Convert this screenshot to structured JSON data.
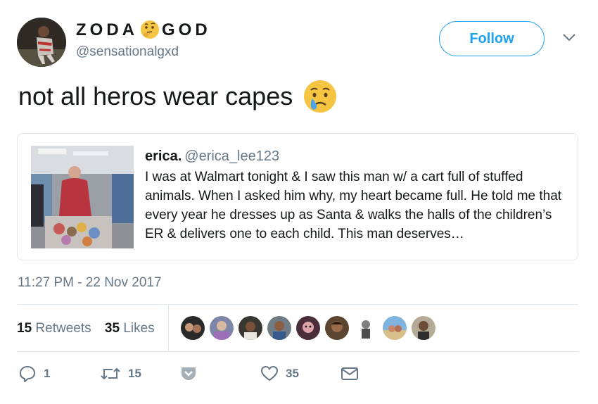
{
  "user": {
    "name_part1": "ZODA",
    "name_part2": "GOD",
    "name_emoji": "thinking-face-emoji",
    "handle": "@sensationalgxd"
  },
  "follow_label": "Follow",
  "tweet": {
    "text": "not all heros wear capes",
    "emoji": "crying-face-emoji"
  },
  "quote": {
    "name": "erica.",
    "handle": "@erica_lee123",
    "text": "I was at Walmart tonight & I saw this man w/ a cart full of stuffed animals. When I asked him why, my heart became full. He told me that every year he dresses up as Santa & walks the halls of the children’s ER & delivers one to each child. This man deserves…"
  },
  "timestamp": "11:27 PM - 22 Nov 2017",
  "stats": {
    "retweets_count": "15",
    "retweets_label": "Retweets",
    "likes_count": "35",
    "likes_label": "Likes"
  },
  "likers_count_shown": 9,
  "actions": {
    "reply_count": "1",
    "retweet_count": "15",
    "like_count": "35"
  },
  "colors": {
    "accent": "#1da1f2",
    "text": "#14171a",
    "muted": "#657786",
    "border": "#e1e8ed"
  }
}
